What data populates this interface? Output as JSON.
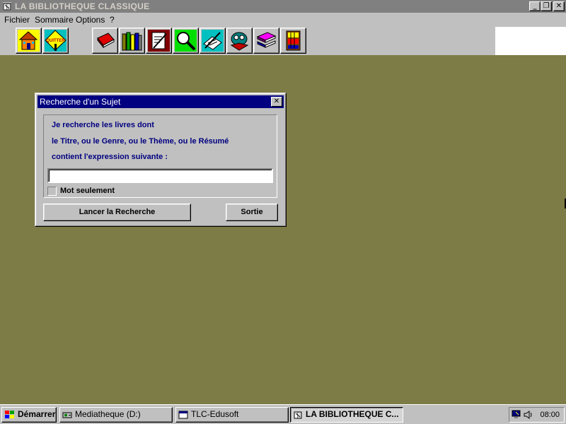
{
  "window": {
    "title": "LA BIBLIOTHEQUE CLASSIQUE",
    "controls": {
      "minimize": "_",
      "restore": "❐",
      "close": "✕"
    }
  },
  "menu": {
    "items": [
      {
        "label": "Fichier",
        "icon": ""
      },
      {
        "label": "Sommaire"
      },
      {
        "label": "Options"
      },
      {
        "label": "?"
      }
    ]
  },
  "toolbar": {
    "quitter_label": "QUITTER",
    "buttons": [
      "home-icon",
      "quit-sign-icon",
      "red-book-icon",
      "books-shelf-icon",
      "writing-icon",
      "magnifier-icon",
      "open-book-icon",
      "reading-face-icon",
      "stacked-books-icon",
      "bookcase-icon"
    ]
  },
  "dialog": {
    "title": "Recherche d'un Sujet",
    "close_label": "✕",
    "line1": "Je recherche les livres dont",
    "line2": "le Titre, ou le Genre, ou le Thème, ou le Résumé",
    "line3": "contient l'expression suivante :",
    "input_value": "",
    "checkbox_label": "Mot seulement",
    "search_button": "Lancer la Recherche",
    "exit_button": "Sortie"
  },
  "taskbar": {
    "start_label": "Démarrer",
    "tasks": [
      {
        "label": "Mediatheque (D:)"
      },
      {
        "label": "TLC-Edusoft"
      },
      {
        "label": "LA BIBLIOTHEQUE C..."
      }
    ],
    "clock": "08:00"
  },
  "colors": {
    "workspace": "#7e7c46",
    "dialog_title_bar": "#000080",
    "dialog_text": "#000080",
    "inactive_title_bar": "#808080"
  }
}
